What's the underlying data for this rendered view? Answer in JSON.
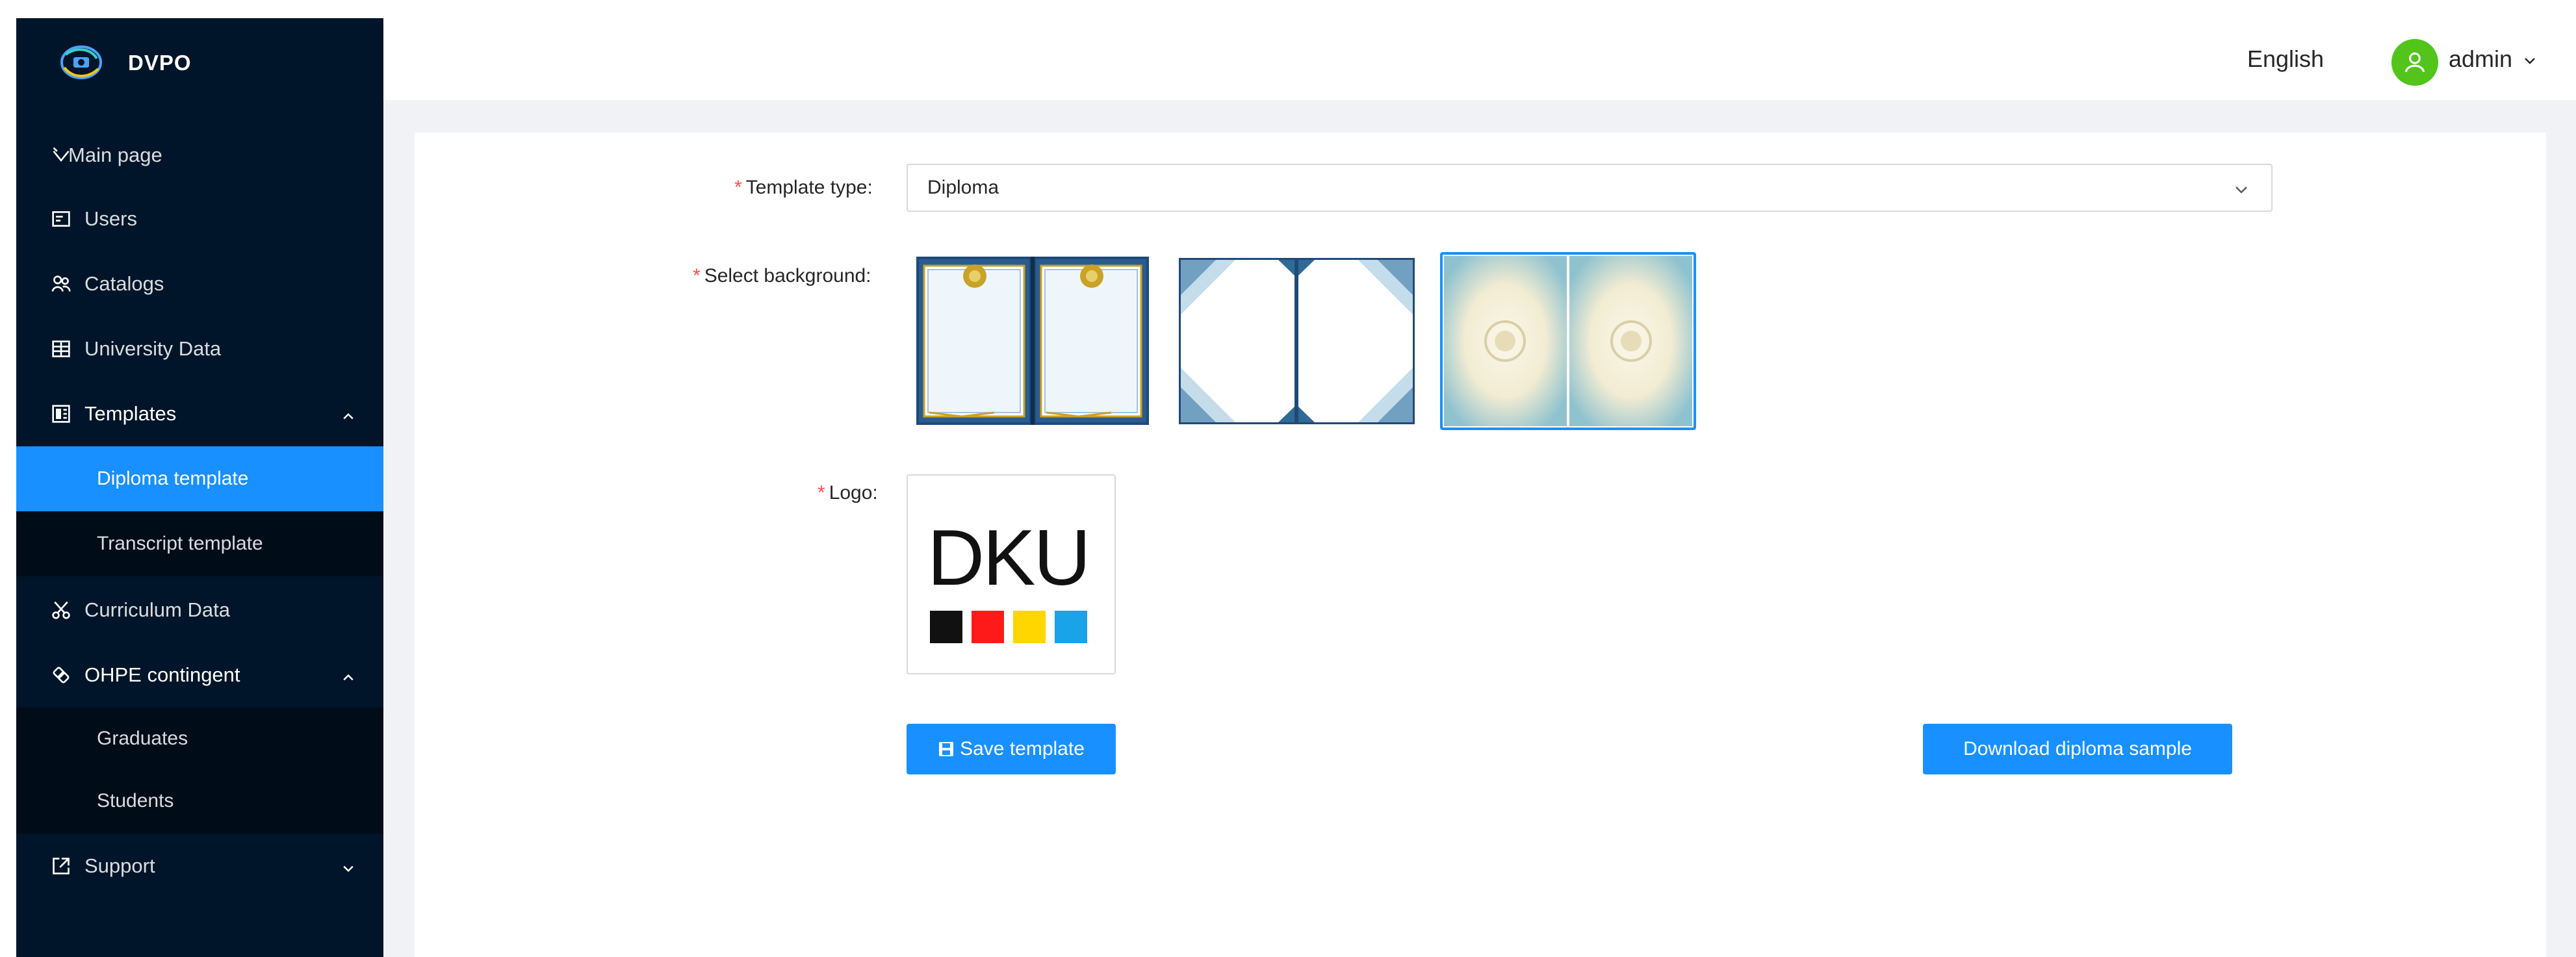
{
  "app": {
    "name": "DVPO"
  },
  "sidebar": {
    "items": [
      {
        "label": "Main page",
        "icon": "dashboard-icon"
      },
      {
        "label": "Users",
        "icon": "id-card-icon"
      },
      {
        "label": "Catalogs",
        "icon": "team-icon"
      },
      {
        "label": "University Data",
        "icon": "table-icon"
      },
      {
        "label": "Templates",
        "icon": "template-icon",
        "expanded": true,
        "children": [
          {
            "label": "Diploma template",
            "active": true
          },
          {
            "label": "Transcript template"
          }
        ]
      },
      {
        "label": "Curriculum Data",
        "icon": "scissor-icon"
      },
      {
        "label": "OHPE contingent",
        "icon": "api-icon",
        "expanded": true,
        "children": [
          {
            "label": "Graduates"
          },
          {
            "label": "Students"
          }
        ]
      },
      {
        "label": "Support",
        "icon": "export-icon",
        "expanded": false
      }
    ]
  },
  "header": {
    "language": "English",
    "user": "admin"
  },
  "form": {
    "template_type_label": "Template type:",
    "template_type_value": "Diploma",
    "background_label": "Select background:",
    "backgrounds": [
      {
        "name": "background-gold-emblem",
        "selected": false
      },
      {
        "name": "background-blue-corners",
        "selected": false
      },
      {
        "name": "background-light-seal",
        "selected": true
      }
    ],
    "logo_label": "Logo:",
    "logo_text": "DKU",
    "logo_colors": [
      "#111111",
      "#ff1a1a",
      "#ffd600",
      "#1aa3e8"
    ],
    "save_button": "Save template",
    "download_button": "Download diploma sample"
  },
  "colors": {
    "sidebar_bg": "#001529",
    "accent": "#1890ff",
    "required": "#ff4d4f",
    "avatar": "#52c41a"
  }
}
